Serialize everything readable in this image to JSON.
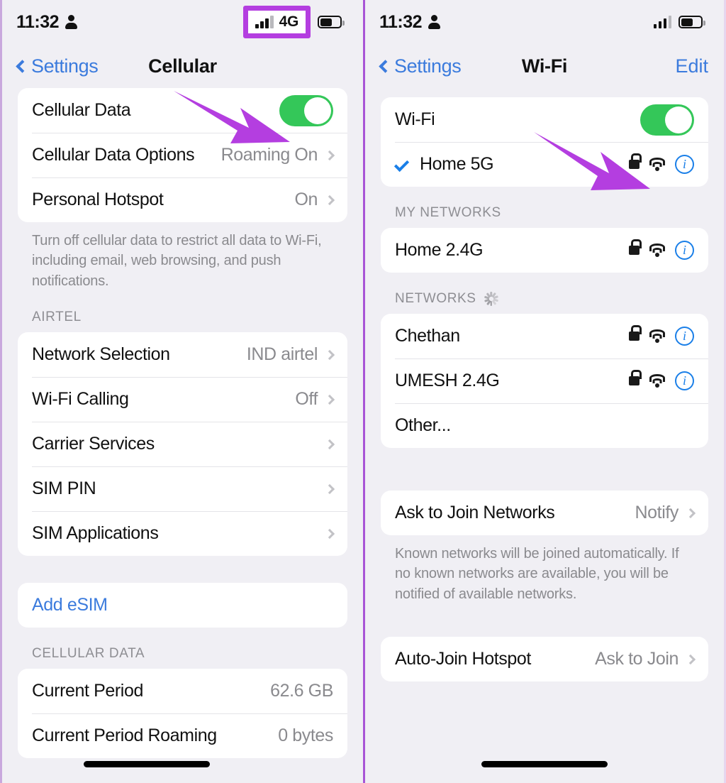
{
  "theme": {
    "accent_purple": "#b43ee0",
    "toggle_green": "#34c759",
    "link_blue": "#3b7bdd",
    "background": "#f0eff4"
  },
  "cellular_screen": {
    "status_bar": {
      "time": "11:32",
      "person_icon": "person-icon",
      "signal_icon": "signal-bars-icon",
      "network_type": "4G",
      "battery_icon": "battery-icon"
    },
    "nav": {
      "back_label": "Settings",
      "title": "Cellular"
    },
    "data_card": [
      {
        "label": "Cellular Data",
        "value": "",
        "type": "toggle",
        "toggle_on": true
      },
      {
        "label": "Cellular Data Options",
        "value": "Roaming On",
        "type": "disclosure"
      },
      {
        "label": "Personal Hotspot",
        "value": "On",
        "type": "disclosure"
      }
    ],
    "data_footnote": "Turn off cellular data to restrict all data to Wi-Fi, including email, web browsing, and push notifications.",
    "carrier_section_header": "AIRTEL",
    "carrier_card": [
      {
        "label": "Network Selection",
        "value": "IND airtel",
        "type": "disclosure"
      },
      {
        "label": "Wi-Fi Calling",
        "value": "Off",
        "type": "disclosure"
      },
      {
        "label": "Carrier Services",
        "value": "",
        "type": "disclosure"
      },
      {
        "label": "SIM PIN",
        "value": "",
        "type": "disclosure"
      },
      {
        "label": "SIM Applications",
        "value": "",
        "type": "disclosure"
      }
    ],
    "esim_card": [
      {
        "label": "Add eSIM",
        "value": "",
        "type": "link"
      }
    ],
    "usage_section_header": "CELLULAR DATA",
    "usage_card": [
      {
        "label": "Current Period",
        "value": "62.6 GB",
        "type": "plain"
      },
      {
        "label": "Current Period Roaming",
        "value": "0 bytes",
        "type": "plain"
      }
    ]
  },
  "wifi_screen": {
    "status_bar": {
      "time": "11:32",
      "person_icon": "person-icon",
      "signal_icon": "signal-bars-icon",
      "battery_icon": "battery-icon"
    },
    "nav": {
      "back_label": "Settings",
      "title": "Wi-Fi",
      "edit_label": "Edit"
    },
    "wifi_card": {
      "toggle_label": "Wi-Fi",
      "toggle_on": true,
      "connected_network": {
        "name": "Home 5G",
        "connected": true,
        "secured": true
      }
    },
    "my_networks_header": "MY NETWORKS",
    "my_networks": [
      {
        "name": "Home 2.4G",
        "secured": true
      }
    ],
    "networks_header": "NETWORKS",
    "networks_scanning": true,
    "networks": [
      {
        "name": "Chethan",
        "secured": true
      },
      {
        "name": "UMESH 2.4G",
        "secured": true
      },
      {
        "name": "Other...",
        "secured": false,
        "plain": true
      }
    ],
    "ask_to_join": {
      "label": "Ask to Join Networks",
      "value": "Notify"
    },
    "ask_to_join_footnote": "Known networks will be joined automatically. If no known networks are available, you will be notified of available networks.",
    "auto_join_hotspot": {
      "label": "Auto-Join Hotspot",
      "value": "Ask to Join"
    }
  }
}
